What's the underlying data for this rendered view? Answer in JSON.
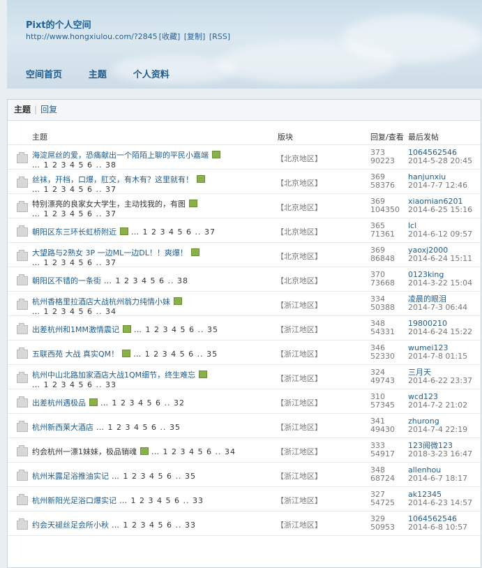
{
  "header": {
    "site_title": "Pixt的个人空间",
    "url": "http://www.hongxiulou.com/?2845",
    "fav": "[收藏]",
    "copy": "[复制]",
    "rss": "[RSS]"
  },
  "nav": [
    "空间首页",
    "主题",
    "个人资料"
  ],
  "tabs": {
    "active": "主题",
    "other": "回复"
  },
  "columns": {
    "topic": "主题",
    "forum": "版块",
    "replies": "回复/查看",
    "last": "最后发帖"
  },
  "threads": [
    {
      "title": "海淀屌丝的爱，恐痛献出一个陌陌上聊的平民小嘉端",
      "hl": true,
      "attach": true,
      "pages": "… 1 2 3 4 5 6 .. 38",
      "inline": false,
      "forum": "【北京地区】",
      "replies": "373",
      "views": "90223",
      "user": "1064562546",
      "time": "2014-5-28 20:45"
    },
    {
      "title": "丝袜，开档，口爆，肛交，有木有？这里就有！",
      "hl": true,
      "attach": true,
      "pages": "… 1 2 3 4 5 6 .. 37",
      "inline": false,
      "forum": "【北京地区】",
      "replies": "369",
      "views": "58376",
      "user": "hanjunxiu",
      "time": "2014-7-7 12:46"
    },
    {
      "title": "特别漂亮的良家女大学生，主动找我的，有图",
      "hl": false,
      "attach": true,
      "pages": "… 1 2 3 4 5 6 .. 37",
      "inline": false,
      "forum": "【北京地区】",
      "replies": "369",
      "views": "104350",
      "user": "xiaomian6201",
      "time": "2014-6-25 15:16"
    },
    {
      "title": "朝阳区东三环长虹桥附近",
      "hl": true,
      "attach": true,
      "pages": "… 1 2 3 4 5 6 .. 37",
      "inline": true,
      "forum": "【北京地区】",
      "replies": "365",
      "views": "71361",
      "user": "lcl",
      "time": "2014-6-12 09:57"
    },
    {
      "title": "大望路与2熟女 3P 一边ML一边DL！！爽爆！",
      "hl": true,
      "attach": true,
      "pages": "… 1 2 3 4 5 6 .. 37",
      "inline": false,
      "forum": "【北京地区】",
      "replies": "369",
      "views": "86848",
      "user": "yaoxj2000",
      "time": "2014-6-24 15:11"
    },
    {
      "title": "朝阳区不错的一条街",
      "hl": true,
      "attach": false,
      "pages": "… 1 2 3 4 5 6 .. 38",
      "inline": true,
      "forum": "【北京地区】",
      "replies": "370",
      "views": "73668",
      "user": "0123king",
      "time": "2014-3-22 15:04"
    },
    {
      "title": "杭州香格里拉酒店大战杭州翁力纯情小妹",
      "hl": true,
      "attach": true,
      "pages": "… 1 2 3 4 5 6 .. 34",
      "inline": false,
      "forum": "【浙江地区】",
      "replies": "334",
      "views": "50388",
      "user": "凌晨的眼泪",
      "time": "2014-7-3 06:44"
    },
    {
      "title": "出差杭州和1MM激情震记",
      "hl": true,
      "attach": true,
      "pages": "… 1 2 3 4 5 6 .. 35",
      "inline": true,
      "forum": "【浙江地区】",
      "replies": "348",
      "views": "54331",
      "user": "19800210",
      "time": "2014-6-24 15:22"
    },
    {
      "title": "五联西苑 大战 真实QM！",
      "hl": true,
      "attach": true,
      "pages": "… 1 2 3 4 5 6 .. 35",
      "inline": true,
      "forum": "【浙江地区】",
      "replies": "346",
      "views": "52330",
      "user": "wumei123",
      "time": "2014-7-8 01:15"
    },
    {
      "title": "杭州中山北路加家酒店大战1QM细节，终生难忘",
      "hl": true,
      "attach": true,
      "pages": "… 1 2 3 4 5 6 .. 33",
      "inline": false,
      "forum": "【浙江地区】",
      "replies": "324",
      "views": "49743",
      "user": "三月天",
      "time": "2014-6-22 23:37"
    },
    {
      "title": "出差杭州遇极品",
      "hl": true,
      "attach": true,
      "pages": "… 1 2 3 4 5 6 .. 32",
      "inline": true,
      "forum": "【浙江地区】",
      "replies": "310",
      "views": "57345",
      "user": "wcd123",
      "time": "2014-7-2 21:02"
    },
    {
      "title": "杭州新西莱大酒店",
      "hl": true,
      "attach": false,
      "pages": "… 1 2 3 4 5 6 .. 35",
      "inline": true,
      "forum": "【浙江地区】",
      "replies": "341",
      "views": "49430",
      "user": "zhurong",
      "time": "2014-7-4 22:19"
    },
    {
      "title": "约会杭州一漂1妹妹，极品销魂",
      "hl": false,
      "attach": true,
      "pages": "… 1 2 3 4 5 6 .. 34",
      "inline": true,
      "forum": "【浙江地区】",
      "replies": "333",
      "views": "54917",
      "user": "123阅微123",
      "time": "2018-3-23 16:47"
    },
    {
      "title": "杭州米露足浴推油实记",
      "hl": true,
      "attach": false,
      "pages": "… 1 2 3 4 5 6 .. 35",
      "inline": true,
      "forum": "【浙江地区】",
      "replies": "348",
      "views": "68724",
      "user": "allenhou",
      "time": "2014-6-7 18:17"
    },
    {
      "title": "杭州新阳光足浴口爆实记",
      "hl": true,
      "attach": false,
      "pages": "… 1 2 3 4 5 6 .. 33",
      "inline": true,
      "forum": "【浙江地区】",
      "replies": "327",
      "views": "54725",
      "user": "ak12345",
      "time": "2014-6-23 14:57"
    },
    {
      "title": "约会天褪丝足会所小秋",
      "hl": true,
      "attach": false,
      "pages": "… 1 2 3 4 5 6 .. 33",
      "inline": true,
      "forum": "【浙江地区】",
      "replies": "329",
      "views": "50953",
      "user": "1064562546",
      "time": "2014-6-8 10:57"
    }
  ]
}
